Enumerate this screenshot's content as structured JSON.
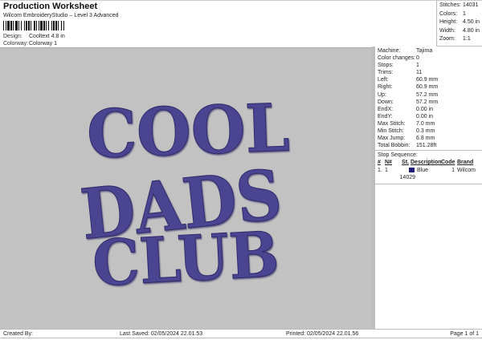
{
  "header": {
    "title": "Production Worksheet",
    "subtitle": "Wilcom EmbroideryStudio – Level 3 Advanced",
    "design_label": "Design:",
    "design_value": "Cooltext 4.8 in",
    "colorway_label": "Colorway:",
    "colorway_value": "Colorway 1"
  },
  "stats": [
    {
      "label": "Stitches:",
      "value": "14031"
    },
    {
      "label": "Colors:",
      "value": "1"
    },
    {
      "label": "Height:",
      "value": "4.50 in"
    },
    {
      "label": "Width:",
      "value": "4.80 in"
    },
    {
      "label": "Zoom:",
      "value": "1:1"
    }
  ],
  "info": [
    {
      "label": "Machine:",
      "value": "Tajima"
    },
    {
      "label": "Color changes:",
      "value": "0"
    },
    {
      "label": "Stops:",
      "value": "1"
    },
    {
      "label": "Trims:",
      "value": "11"
    },
    {
      "label": "Left:",
      "value": "60.9 mm"
    },
    {
      "label": "Right:",
      "value": "60.9 mm"
    },
    {
      "label": "Up:",
      "value": "57.2 mm"
    },
    {
      "label": "Down:",
      "value": "57.2 mm"
    },
    {
      "label": "EndX:",
      "value": "0.00 in"
    },
    {
      "label": "EndY:",
      "value": "0.00 in"
    },
    {
      "label": "Max Stitch:",
      "value": "7.0 mm"
    },
    {
      "label": "Min Stitch:",
      "value": "0.3 mm"
    },
    {
      "label": "Max Jump:",
      "value": "6.8 mm"
    },
    {
      "label": "Total Bobbin:",
      "value": "151.28ft"
    }
  ],
  "stop_sequence": {
    "title": "Stop Sequence:",
    "headers": [
      "#",
      "N#",
      "St.",
      "Description",
      "Code",
      "Brand"
    ],
    "rows": [
      {
        "num": "1.",
        "n": "1",
        "color": "#1e1a7a",
        "st": "14029",
        "description": "Blue",
        "code": "1",
        "brand": "Wilcom"
      }
    ]
  },
  "design": {
    "thread_color": "#4b4591",
    "lines": [
      "COOL",
      "DADS",
      "CLUB"
    ]
  },
  "footer": {
    "created_by": "Created By:",
    "last_saved": "Last Saved: 02/05/2024 22.01.53",
    "printed": "Printed: 02/05/2024 22.01.56",
    "page": "Page 1 of 1"
  }
}
